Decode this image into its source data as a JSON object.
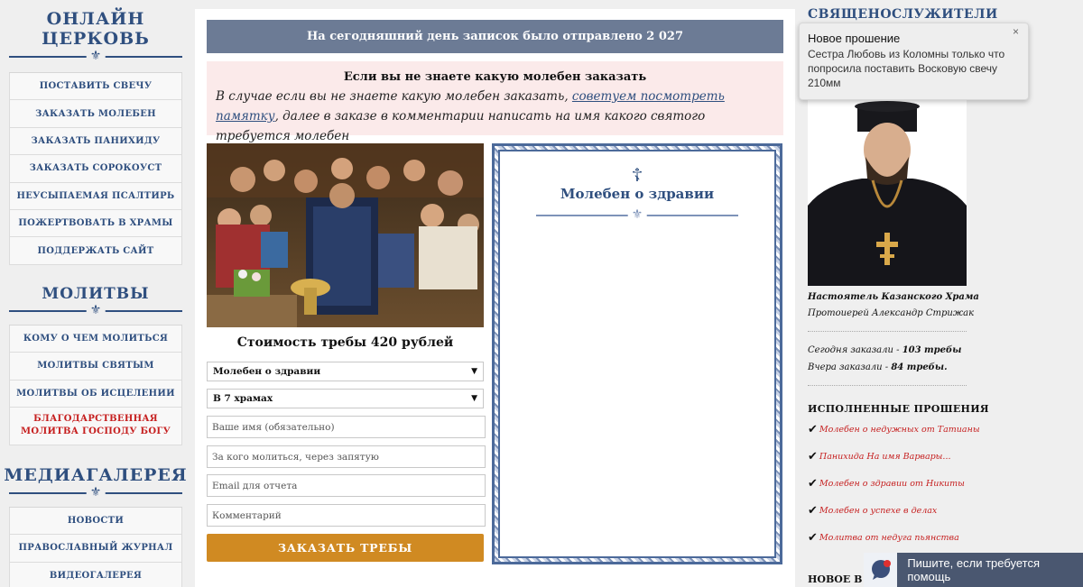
{
  "sidebar": {
    "section1_title": "ОНЛАЙН ЦЕРКОВЬ",
    "section1_items": [
      {
        "label": "ПОСТАВИТЬ СВЕЧУ"
      },
      {
        "label": "ЗАКАЗАТЬ МОЛЕБЕН"
      },
      {
        "label": "ЗАКАЗАТЬ ПАНИХИДУ"
      },
      {
        "label": "ЗАКАЗАТЬ СОРОКОУСТ"
      },
      {
        "label": "НЕУСЫПАЕМАЯ ПСАЛТИРЬ"
      },
      {
        "label": "ПОЖЕРТВОВАТЬ В ХРАМЫ"
      },
      {
        "label": "ПОДДЕРЖАТЬ САЙТ"
      }
    ],
    "section2_title": "МОЛИТВЫ",
    "section2_items": [
      {
        "label": "КОМУ О ЧЕМ МОЛИТЬСЯ"
      },
      {
        "label": "МОЛИТВЫ СВЯТЫМ"
      },
      {
        "label": "МОЛИТВЫ ОБ ИСЦЕЛЕНИИ"
      },
      {
        "label": "БЛАГОДАРСТВЕННАЯ МОЛИТВА ГОСПОДУ БОГУ"
      }
    ],
    "section3_title": "МЕДИАГАЛЕРЕЯ",
    "section3_items": [
      {
        "label": "НОВОСТИ"
      },
      {
        "label": "ПРАВОСЛАВНЫЙ ЖУРНАЛ"
      },
      {
        "label": "ВИДЕОГАЛЕРЕЯ"
      }
    ]
  },
  "main": {
    "counter_text": "На сегодняшний день записок было отправлено 2 027",
    "notice_title": "Если вы не знаете какую молебен заказать",
    "notice_text_before": "В случае если вы не знаете какую молебен заказать, ",
    "notice_link": "советуем посмотреть памятку",
    "notice_text_after": ", далее в заказе в комментарии написать на имя какого святого требуется молебен",
    "price_text": "Стоимость требы 420 рублей",
    "select_service": "Молебен о здравии",
    "select_temples": "В 7 храмах",
    "name_placeholder": "Ваше имя (обязательно)",
    "for_whom_placeholder": "За кого молиться, через запятую",
    "email_placeholder": "Email для отчета",
    "comment_placeholder": "Комментарий",
    "submit_label": "ЗАКАЗАТЬ ТРЕБЫ",
    "frame_title": "Молебен о здравии"
  },
  "right": {
    "title": "СВЯЩЕНОСЛУЖИТЕЛИ",
    "priest_caption": "Настоятель Казанского Храма",
    "priest_name": "Протоиерей Александр Стрижак",
    "today_label": "Сегодня заказали - ",
    "today_value": "103 требы",
    "yesterday_label": "Вчера заказали - ",
    "yesterday_value": "84 требы.",
    "done_title": "ИСПОЛНЕННЫЕ ПРОШЕНИЯ",
    "done_items": [
      {
        "text": "Молебен о недужных от Татианы"
      },
      {
        "text": "Панихида На имя Варвары..."
      },
      {
        "text": "Молебен о здравии от Никиты"
      },
      {
        "text": "Молебен о успехе в делах"
      },
      {
        "text": "Молитва от недуга пьянства"
      }
    ],
    "new_title": "НОВОЕ В Ц"
  },
  "toast": {
    "title": "Новое прошение",
    "text": "Сестра Любовь из Коломны только что попросила поставить Восковую свечу 210мм",
    "close": "×"
  },
  "chat": {
    "label": "Пишите, если требуется помощь"
  },
  "colors": {
    "accent": "#2f4f7f",
    "button": "#d08a22",
    "banner": "#6c7b95",
    "notice_bg": "#fbeaea",
    "highlight_red": "#c62020"
  }
}
